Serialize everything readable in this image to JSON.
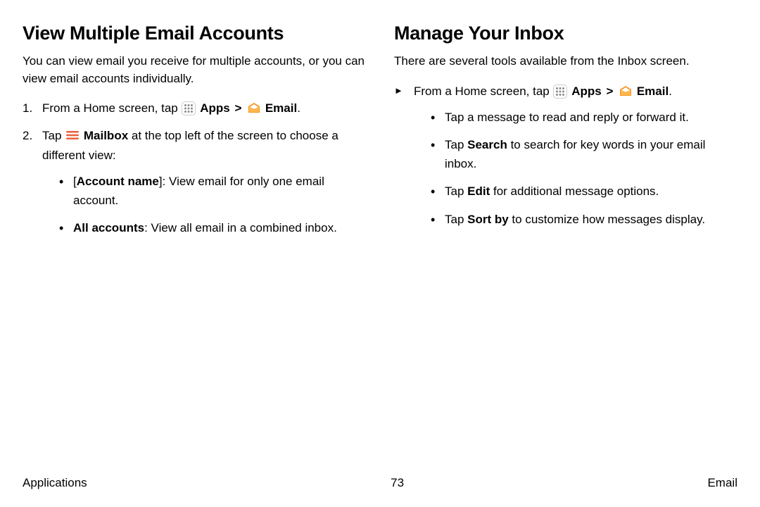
{
  "left": {
    "heading": "View Multiple Email Accounts",
    "intro": "You can view email you receive for multiple accounts, or you can view email accounts individually.",
    "step1": {
      "pre": "From a Home screen, tap ",
      "apps": "Apps",
      "email": "Email",
      "post": "."
    },
    "step2": {
      "pre": "Tap ",
      "mailbox": "Mailbox",
      "post": " at the top left of the screen to choose a different view:"
    },
    "sub1": {
      "label_open": "[",
      "label": "Account name",
      "label_close": "]",
      "text": ": View email for only one email account."
    },
    "sub2": {
      "label": "All accounts",
      "text": ": View all email in a combined inbox."
    }
  },
  "right": {
    "heading": "Manage Your Inbox",
    "intro": "There are several tools available from the Inbox screen.",
    "step": {
      "pre": "From a Home screen, tap ",
      "apps": "Apps",
      "email": "Email",
      "post": "."
    },
    "b1": "Tap a message to read and reply or forward it.",
    "b2": {
      "pre": "Tap ",
      "bold": "Search",
      "post": " to search for key words in your email inbox."
    },
    "b3": {
      "pre": "Tap ",
      "bold": "Edit",
      "post": " for additional message options."
    },
    "b4": {
      "pre": "Tap ",
      "bold": "Sort by",
      "post": " to customize how messages display."
    }
  },
  "footer": {
    "left": "Applications",
    "center": "73",
    "right": "Email"
  },
  "glyphs": {
    "chevron": ">"
  }
}
